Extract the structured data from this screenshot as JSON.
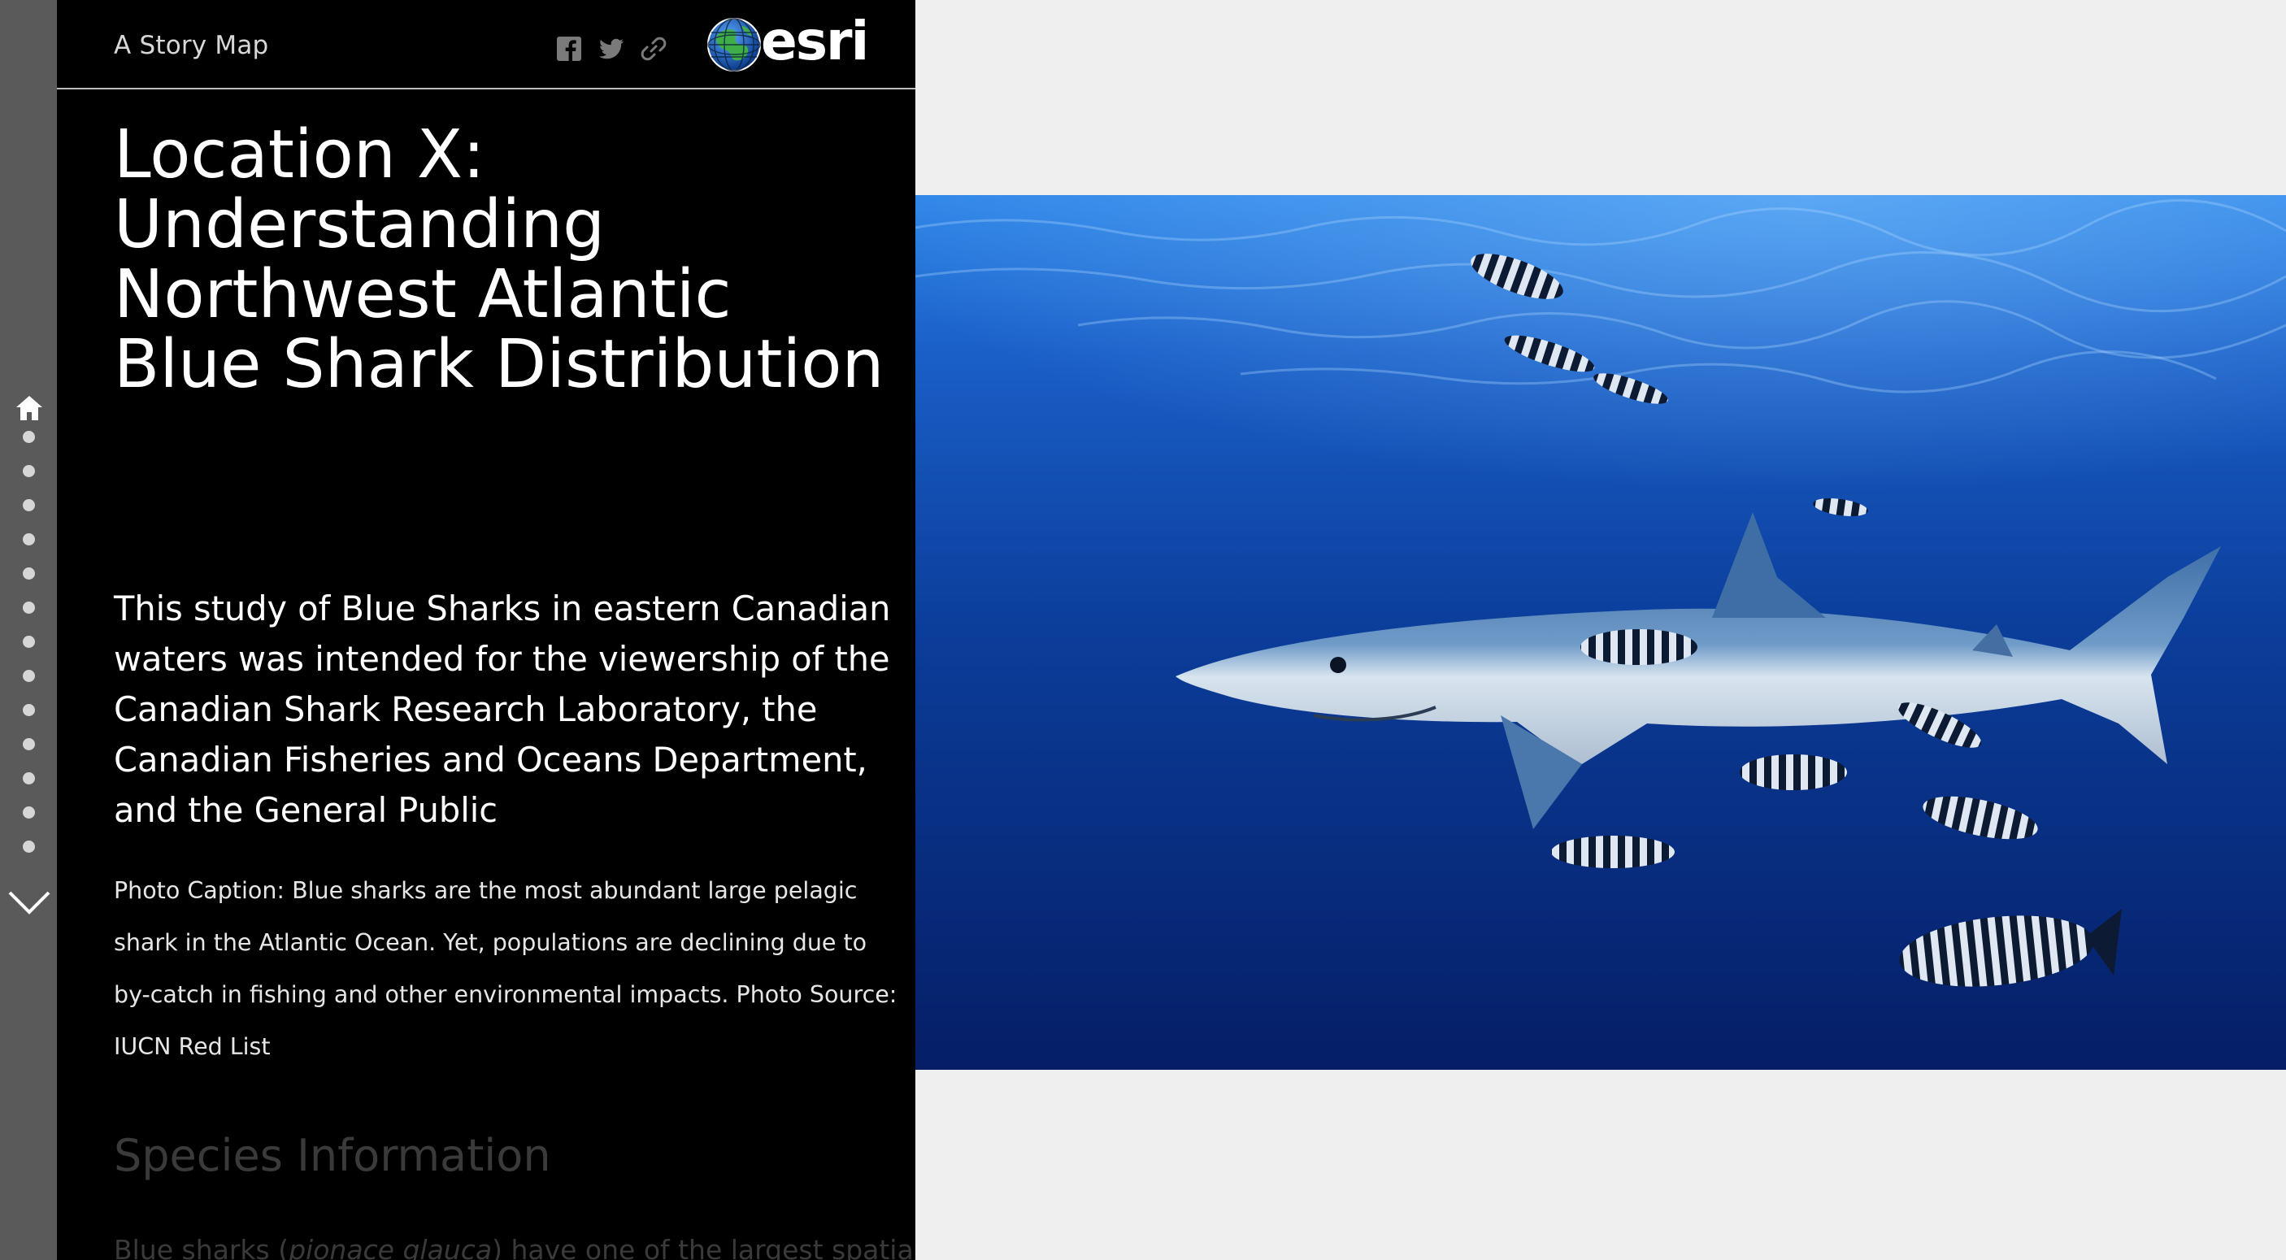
{
  "header": {
    "title": "A Story Map",
    "logo_text": "esri",
    "share_icons": [
      "facebook-icon",
      "twitter-icon",
      "link-icon"
    ]
  },
  "navigation": {
    "home_icon": "home-icon",
    "dot_count": 13,
    "down_icon": "chevron-down-icon"
  },
  "story": {
    "title": "Location X: Understanding Northwest Atlantic Blue Shark Distribution",
    "intro": "This study of Blue Sharks in eastern Canadian waters was intended for the viewership of the Canadian Shark Research Laboratory, the Canadian Fisheries and Oceans Department, and the General Public",
    "caption": "Photo Caption: Blue sharks are the most abundant large pelagic shark in the Atlantic Ocean. Yet, populations are declining due to by-catch in fishing and other environmental impacts. Photo Source: IUCN Red List",
    "section_heading": "Species Information",
    "section_body_start": "Blue sharks (",
    "section_body_species": "pionace glauca",
    "section_body_end": ") have one of the largest spatial"
  },
  "colors": {
    "panel_background": "#000000",
    "nav_strip": "#5a5a5a",
    "page_background": "#efefef",
    "ocean_deep": "#062a7a",
    "ocean_surface": "#1f6fd4"
  }
}
